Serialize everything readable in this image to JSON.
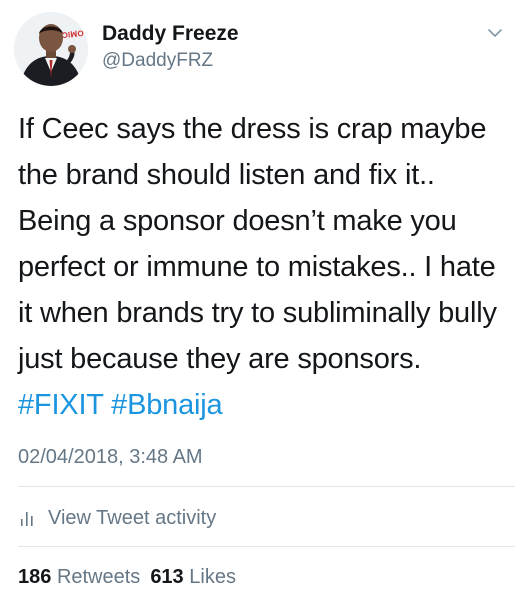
{
  "author": {
    "display_name": "Daddy Freeze",
    "handle": "@DaddyFRZ",
    "avatar_badge": "ƆIꟽO"
  },
  "tweet": {
    "text_segments": [
      "If Ceec says the dress is crap maybe the brand should listen and fix it.. Being a sponsor doesn’t make you perfect or immune to mistakes.. I hate it when brands try to subliminally bully just because they are sponsors. "
    ],
    "hashtags": [
      "#FIXIT",
      "#Bbnaija"
    ],
    "timestamp": "02/04/2018, 3:48 AM"
  },
  "activity": {
    "label": "View Tweet activity",
    "icon": "bar-chart-icon"
  },
  "stats": {
    "retweets_count": "186",
    "retweets_label": "Retweets",
    "likes_count": "613",
    "likes_label": "Likes"
  },
  "colors": {
    "text": "#14171a",
    "secondary": "#657786",
    "link": "#1b95e0",
    "divider": "#e1e8ed"
  }
}
